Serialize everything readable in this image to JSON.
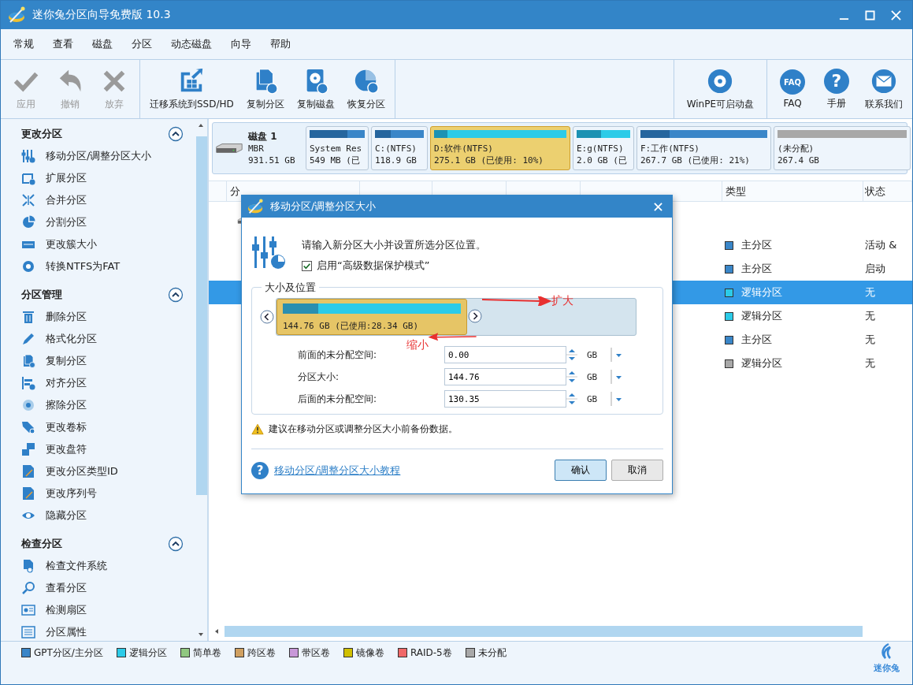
{
  "window": {
    "title": "迷你兔分区向导免费版 10.3"
  },
  "menu": [
    "常规",
    "查看",
    "磁盘",
    "分区",
    "动态磁盘",
    "向导",
    "帮助"
  ],
  "toolbar": {
    "groups": [
      [
        {
          "label": "应用",
          "disabled": true
        },
        {
          "label": "撤销",
          "disabled": true
        },
        {
          "label": "放弃",
          "disabled": true
        }
      ],
      [
        {
          "label": "迁移系统到SSD/HD",
          "disabled": false
        },
        {
          "label": "复制分区",
          "disabled": false
        },
        {
          "label": "复制磁盘",
          "disabled": false
        },
        {
          "label": "恢复分区",
          "disabled": false
        }
      ],
      [
        {
          "label": "WinPE可启动盘",
          "disabled": false
        }
      ],
      [
        {
          "label": "FAQ",
          "glyph": "FAQ",
          "disabled": false
        },
        {
          "label": "手册",
          "glyph": "?",
          "disabled": false
        },
        {
          "label": "联系我们",
          "disabled": false
        }
      ]
    ]
  },
  "sidebar": {
    "sections": [
      {
        "title": "更改分区",
        "expanded": true,
        "items": [
          "移动分区/调整分区大小",
          "扩展分区",
          "合并分区",
          "分割分区",
          "更改簇大小",
          "转换NTFS为FAT"
        ]
      },
      {
        "title": "分区管理",
        "expanded": true,
        "items": [
          "删除分区",
          "格式化分区",
          "复制分区",
          "对齐分区",
          "擦除分区",
          "更改卷标",
          "更改盘符",
          "更改分区类型ID",
          "更改序列号",
          "隐藏分区"
        ]
      },
      {
        "title": "检查分区",
        "expanded": true,
        "items": [
          "检查文件系统",
          "查看分区",
          "检测扇区",
          "分区属性"
        ]
      }
    ]
  },
  "disk_map": {
    "disk": {
      "name": "磁盘 1",
      "type": "MBR",
      "size": "931.51 GB"
    },
    "partitions": [
      {
        "name": "System Res",
        "size": "549 MB (已",
        "color": "#3a86c8",
        "level": 0.68,
        "selected": false
      },
      {
        "name": "C:(NTFS)",
        "size": "118.9 GB",
        "color": "#3a86c8",
        "level": 0.33,
        "selected": false
      },
      {
        "name": "D:软件(NTFS)",
        "size": "275.1 GB (已使用: 10%)",
        "color": "#2ccbe8",
        "level": 0.1,
        "selected": true
      },
      {
        "name": "E:g(NTFS)",
        "size": "2.0 GB (已",
        "color": "#2ccbe8",
        "level": 0.45,
        "selected": false
      },
      {
        "name": "F:工作(NTFS)",
        "size": "267.7 GB (已使用: 21%)",
        "color": "#3a86c8",
        "level": 0.23,
        "selected": false
      },
      {
        "name": "(未分配)",
        "size": "267.4 GB",
        "color": "#a8a8a8",
        "selected": false
      }
    ]
  },
  "table": {
    "columns": [
      "分",
      "类型",
      "状态"
    ],
    "rows": [
      {
        "type": "主分区",
        "color": "#3a86c8",
        "status": "活动 &",
        "selected": false
      },
      {
        "type": "主分区",
        "color": "#3a86c8",
        "status": "启动",
        "selected": false
      },
      {
        "type": "逻辑分区",
        "color": "#2ccbe8",
        "status": "无",
        "selected": true
      },
      {
        "type": "逻辑分区",
        "color": "#2ccbe8",
        "status": "无",
        "selected": false
      },
      {
        "type": "主分区",
        "color": "#3a86c8",
        "status": "无",
        "selected": false
      },
      {
        "type": "逻辑分区",
        "color": "#a8a8a8",
        "status": "无",
        "selected": false
      }
    ]
  },
  "dialog": {
    "title": "移动分区/调整分区大小",
    "intro": "请输入新分区大小并设置所选分区位置。",
    "checkbox": {
      "label": "启用“高级数据保护模式”",
      "checked": true
    },
    "group_title": "大小及位置",
    "slider": {
      "label": "144.76 GB (已使用:28.34 GB)",
      "level": 0.53,
      "used": {
        "level": 0.2
      }
    },
    "annotations": [
      {
        "text": "扩大"
      },
      {
        "text": "缩小"
      }
    ],
    "fields": [
      {
        "label": "前面的未分配空间:",
        "value": "0.00",
        "unit": "GB"
      },
      {
        "label": "分区大小:",
        "value": "144.76",
        "unit": "GB"
      },
      {
        "label": "后面的未分配空间:",
        "value": "130.35",
        "unit": "GB"
      }
    ],
    "warning": "建议在移动分区或调整分区大小前备份数据。",
    "help_glyph": "?",
    "link": "移动分区/调整分区大小教程",
    "buttons": [
      {
        "label": "确认",
        "default": true
      },
      {
        "label": "取消",
        "default": false
      }
    ]
  },
  "legend": [
    {
      "label": "GPT分区/主分区",
      "color": "#3a86c8"
    },
    {
      "label": "逻辑分区",
      "color": "#2ccbe8"
    },
    {
      "label": "简单卷",
      "color": "#90c880"
    },
    {
      "label": "跨区卷",
      "color": "#d0a060"
    },
    {
      "label": "带区卷",
      "color": "#c898d8"
    },
    {
      "label": "镜像卷",
      "color": "#d0c000"
    },
    {
      "label": "RAID-5卷",
      "color": "#f06868"
    },
    {
      "label": "未分配",
      "color": "#a8a8a8"
    }
  ],
  "logo": {
    "text": "迷你兔"
  }
}
